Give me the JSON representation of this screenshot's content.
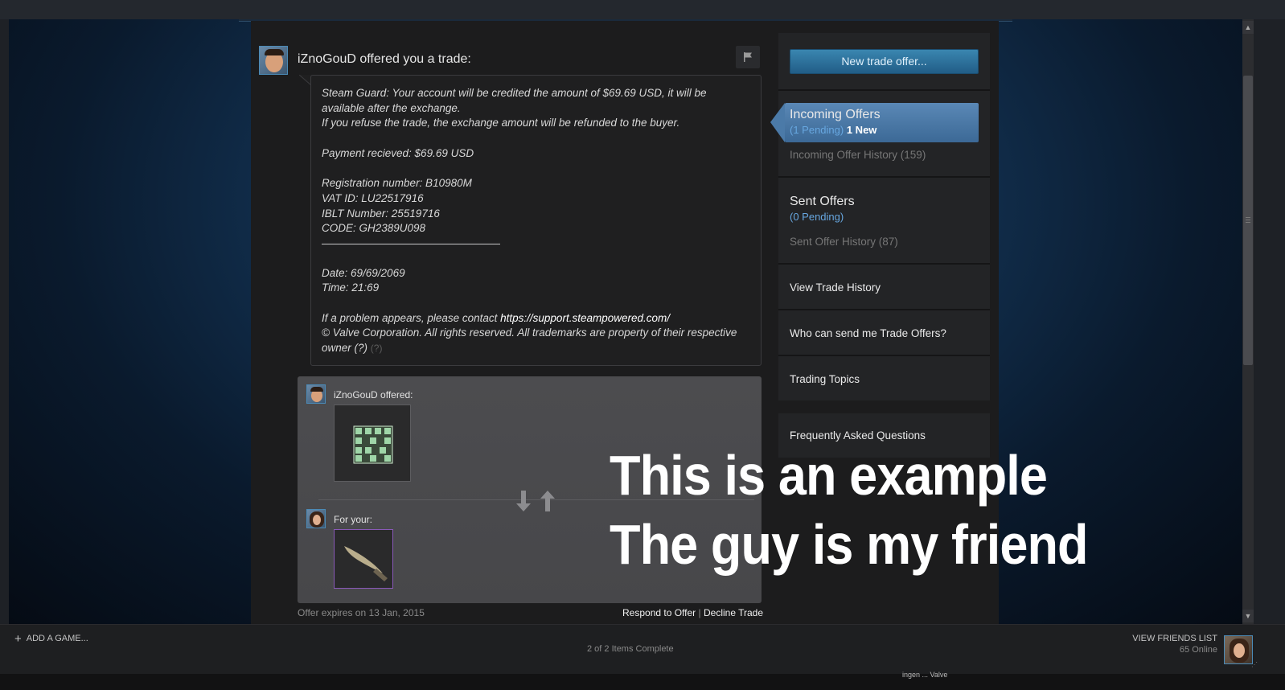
{
  "header": {
    "title": "iZnoGouD offered you a trade:"
  },
  "message": {
    "lines": [
      "Steam Guard: Your account will be credited the amount of $69.69 USD, it will be",
      "available after the exchange.",
      "If you refuse the trade, the exchange amount will be refunded to the buyer.",
      "",
      "Payment recieved: $69.69 USD",
      "",
      "Registration number: B10980M",
      "VAT ID: LU22517916",
      "IBLT Number: 25519716",
      "CODE: GH2389U098"
    ],
    "lines_after_rule": [
      "Date: 69/69/2069",
      "Time: 21:69",
      ""
    ],
    "contact_prefix": "If a problem appears, please contact ",
    "contact_link": "https://support.steampowered.com/",
    "copyright_line1": "© Valve Corporation. All rights reserved. All trademarks are property of their respective",
    "copyright_line2": "owner (?)",
    "help_mark": "(?)"
  },
  "trade": {
    "offered_label": "iZnoGouD offered:",
    "for_your_label": "For your:",
    "expires": "Offer expires on 13 Jan, 2015",
    "respond_label": "Respond to Offer",
    "separator": "|",
    "decline_label": "Decline Trade"
  },
  "sidebar": {
    "new_offer_button": "New trade offer...",
    "incoming_title": "Incoming Offers",
    "incoming_pending": "(1 Pending)",
    "incoming_new": "1 New",
    "incoming_history": "Incoming Offer History (159)",
    "sent_title": "Sent Offers",
    "sent_pending": "(0 Pending)",
    "sent_history": "Sent Offer History (87)",
    "view_trade_history": "View Trade History",
    "who_can_send": "Who can send me Trade Offers?",
    "trading_topics": "Trading Topics",
    "faq": "Frequently Asked Questions"
  },
  "overlay": {
    "line1": "This is an example",
    "line2": "The guy is my friend"
  },
  "bottom_bar": {
    "add_game": "ADD A GAME...",
    "progress": "2 of 2 Items Complete",
    "view_friends": "VIEW FRIENDS LIST",
    "online": "65 Online"
  },
  "colors": {
    "accent_blue": "#67a7e0",
    "button_blue": "#3a86b0",
    "rare_item_border": "#8a59b8"
  },
  "icons": {
    "flag": "flag-icon",
    "swap": "trade-swap-arrows-icon",
    "plus": "plus-icon"
  },
  "taskbar_fragment": "ingen ... Valve"
}
